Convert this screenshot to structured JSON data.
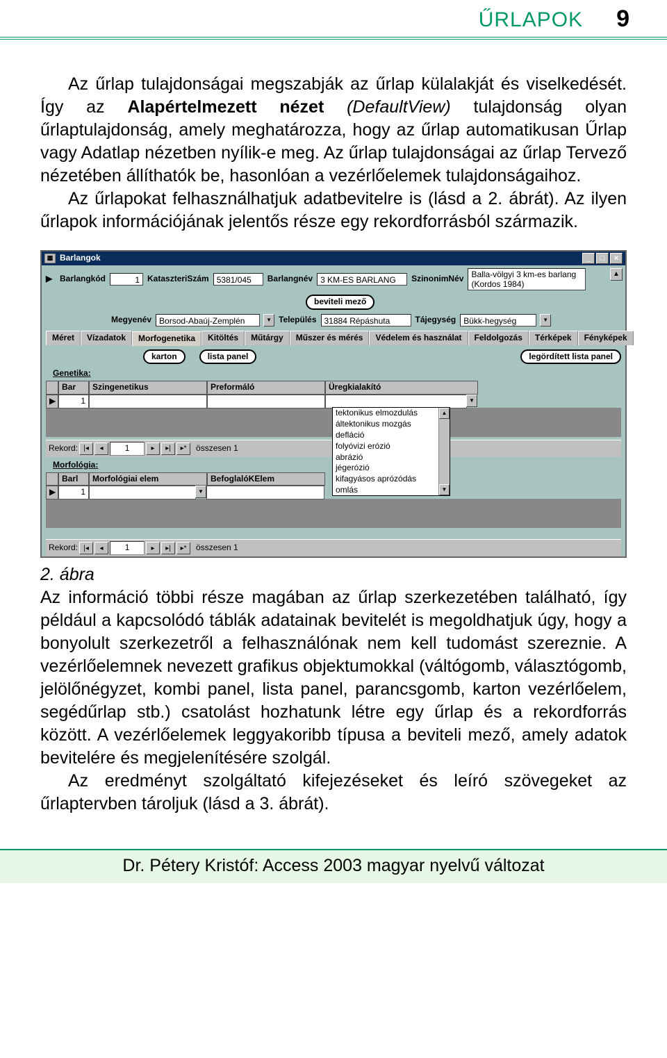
{
  "header": {
    "section": "ŰRLAPOK",
    "page_number": "9"
  },
  "body": {
    "p1": "Az űrlap tulajdonságai megszabják az űrlap külalakját és viselkedését. Így az ",
    "p1_bold": "Alapértelmezett nézet",
    "p1_italic": " (DefaultView)",
    "p1_rest": " tulajdonság olyan űrlaptulajdonság, amely meghatározza, hogy az űrlap automatikusan Űrlap vagy Adatlap nézetben nyílik-e meg. Az űrlap tulajdonságai az űrlap Tervező nézetében állíthatók be, hasonlóan a vezérlőelemek tulajdonságaihoz.",
    "p2": "Az űrlapokat felhasználhatjuk adatbevitelre is (lásd a 2. ábrát). Az ilyen űrlapok információjának jelentős része egy rekordforrásból származik.",
    "caption": "2. ábra",
    "p3": "Az információ többi része magában az űrlap szerkezetében található, így például a kapcsolódó táblák adatainak bevitelét is megoldhatjuk úgy, hogy a bonyolult szerkezetről a felhasználónak nem kell tudomást szereznie. A vezérlőelemnek nevezett grafikus objektumokkal (váltógomb, választógomb, jelölőnégyzet, kombi panel, lista panel, parancsgomb, karton vezérlőelem, segédűrlap stb.) csatolást hozhatunk létre egy űrlap és a rekordforrás között. A vezérlőelemek leggyakoribb típusa a beviteli mező, amely adatok bevitelére és megjelenítésére szolgál.",
    "p4": "Az eredményt szolgáltató kifejezéseket és leíró szövegeket az űrlaptervben tároljuk (lásd a 3. ábrát)."
  },
  "screenshot": {
    "title": "Barlangok",
    "labels": {
      "barlangkod": "Barlangkód",
      "kataszteri": "KataszteriSzám",
      "barlangnev": "Barlangnév",
      "szinonim": "SzinonimNév",
      "megyenev": "Megyenév",
      "telepules": "Település",
      "tajegyseg": "Tájegység"
    },
    "values": {
      "barlangkod": "1",
      "kataszteri": "5381/045",
      "barlangnev": "3 KM-ES BARLANG",
      "szinonim": "Balla-völgyi 3 km-es barlang (Kordos 1984)",
      "megyenev": "Borsod-Abaúj-Zemplén",
      "telepules": "31884 Répáshuta",
      "tajegyseg": "Bükk-hegység"
    },
    "callouts": {
      "beviteli": "beviteli mező",
      "karton": "karton",
      "lista": "lista panel",
      "legorditett": "legördített lista panel"
    },
    "tabs": [
      "Méret",
      "Vízadatok",
      "Morfogenetika",
      "Kitöltés",
      "Műtárgy",
      "Műszer és mérés",
      "Védelem és használat",
      "Feldolgozás",
      "Térképek",
      "Fényképek"
    ],
    "genetika": {
      "heading": "Genetika:",
      "cols": [
        "Bar",
        "Szingenetikus",
        "Preformáló",
        "Üregkialakító"
      ],
      "row": [
        "1",
        "",
        "",
        ""
      ]
    },
    "morfologia": {
      "heading": "Morfológia:",
      "cols": [
        "Barl",
        "Morfológiai elem",
        "BefoglalóKElem"
      ],
      "row": [
        "1",
        "",
        ""
      ]
    },
    "dropdown": [
      "tektonikus elmozdulás",
      "áltektonikus mozgás",
      "defláció",
      "folyóvizi erózió",
      "abrázió",
      "jégerózió",
      "kifagyásos aprózódás",
      "omlás"
    ],
    "recordnav": {
      "label": "Rekord:",
      "value": "1",
      "total": "összesen 1"
    }
  },
  "footer": "Dr. Pétery Kristóf: Access 2003 magyar nyelvű változat"
}
